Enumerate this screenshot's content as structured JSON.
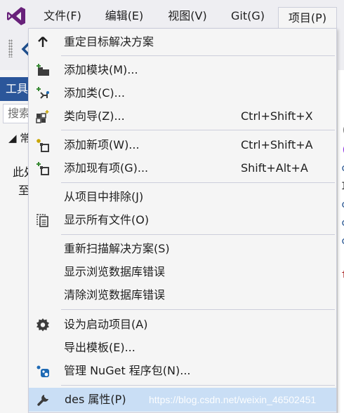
{
  "menubar": {
    "items": [
      {
        "label": "文件(F)"
      },
      {
        "label": "编辑(E)"
      },
      {
        "label": "视图(V)"
      },
      {
        "label": "Git(G)"
      },
      {
        "label": "项目(P)"
      }
    ]
  },
  "toolbox": {
    "header": "工具",
    "search_placeholder": "搜索",
    "group": "◢ 常",
    "text_line1": "此处",
    "text_line2": "至"
  },
  "project_menu": {
    "items": [
      {
        "label": "重定目标解决方案",
        "shortcut": "",
        "icon": "up-arrow-icon"
      },
      {
        "label": "添加模块(M)...",
        "shortcut": "",
        "icon": "add-module-icon"
      },
      {
        "label": "添加类(C)...",
        "shortcut": "",
        "icon": "add-class-icon"
      },
      {
        "label": "类向导(Z)...",
        "shortcut": "Ctrl+Shift+X",
        "icon": "class-wizard-icon"
      },
      {
        "label": "添加新项(W)...",
        "shortcut": "Ctrl+Shift+A",
        "icon": "add-new-item-icon"
      },
      {
        "label": "添加现有项(G)...",
        "shortcut": "Shift+Alt+A",
        "icon": "add-existing-item-icon"
      },
      {
        "label": "从项目中排除(J)",
        "shortcut": "",
        "icon": ""
      },
      {
        "label": "显示所有文件(O)",
        "shortcut": "",
        "icon": "show-all-files-icon"
      },
      {
        "label": "重新扫描解决方案(S)",
        "shortcut": "",
        "icon": ""
      },
      {
        "label": "显示浏览数据库错误",
        "shortcut": "",
        "icon": ""
      },
      {
        "label": "清除浏览数据库错误",
        "shortcut": "",
        "icon": ""
      },
      {
        "label": "设为启动项目(A)",
        "shortcut": "",
        "icon": "gear-icon"
      },
      {
        "label": "导出模板(E)...",
        "shortcut": "",
        "icon": ""
      },
      {
        "label": "管理 NuGet 程序包(N)...",
        "shortcut": "",
        "icon": "nuget-icon"
      },
      {
        "label": "des 属性(P)",
        "shortcut": "",
        "icon": "wrench-icon"
      }
    ],
    "watermark": "https://blog.csdn.net/weixin_46502451"
  },
  "colors": {
    "menubar_bg": "#eeeef2",
    "menu_bg": "#f5f5f5",
    "highlight": "#c9def5",
    "vs_purple": "#68217a",
    "accent_blue": "#2b569a"
  }
}
